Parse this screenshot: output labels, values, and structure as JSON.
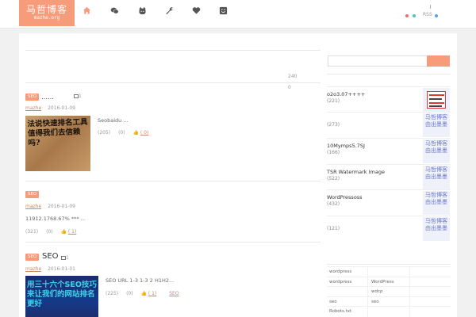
{
  "header": {
    "logo_title": "马哲博客",
    "logo_sub": "mazhe.org",
    "nav": [
      {
        "icon": "home-icon",
        "color": "#f79c7b"
      },
      {
        "icon": "wechat-icon",
        "color": "#555555"
      },
      {
        "icon": "github-icon",
        "color": "#555555"
      },
      {
        "icon": "wrench-icon",
        "color": "#555555"
      },
      {
        "icon": "heart-icon",
        "color": "#555555"
      },
      {
        "icon": "smiley-icon",
        "color": "#555555"
      }
    ],
    "rss_label": "RSS",
    "dot_colors": [
      "#f06b6b",
      "#4cc2c4",
      "#f7b34a",
      "#5aa0e8"
    ]
  },
  "stats": {
    "a": "240",
    "b": "0"
  },
  "posts": [
    {
      "tag": "SEO",
      "title": "……",
      "img_count": "1",
      "author": "mazhe",
      "date": "2016-01-09",
      "excerpt": "Seobaidu ...",
      "views": "(205)",
      "comments": "(0)",
      "likes": "( 0)",
      "thumb_text": "法说快速排名工具值得我们去信赖吗?"
    },
    {
      "tag": "SEO",
      "title": "",
      "author": "mazhe",
      "date": "2016-01-09",
      "excerpt": "11912.1768.67% *** ...",
      "views": "(321)",
      "comments": "(0)",
      "likes": "( 1)"
    },
    {
      "tag": "SEO",
      "title": "SEO",
      "img_count": "1",
      "author": "mazhe",
      "date": "2016-01-01",
      "excerpt": "SEO  URL 1-3 1-3 2    H1H2...",
      "views": "(225)",
      "comments": "(0)",
      "likes": "( 1)",
      "cat": "SEO",
      "thumb_text": "用三十六个SEO技巧来让我们的网站排名更好"
    }
  ],
  "sidebar": {
    "search_placeholder": "",
    "items": [
      {
        "title": "o2o3.07++++",
        "count": "(221)",
        "img": "redbox"
      },
      {
        "title": "",
        "count": "(273)",
        "img": "seal"
      },
      {
        "title": "10Mymps5.7SJ",
        "count": "(166)",
        "img": "seal"
      },
      {
        "title": "TSR Watermark Image",
        "count": "(522)",
        "img": "seal"
      },
      {
        "title": "WordPressoss",
        "count": "(432)",
        "img": "seal"
      },
      {
        "title": "",
        "count": "(121)",
        "img": "seal"
      }
    ],
    "seal_text": "马哲博客 由出墨墨",
    "tags": [
      [
        "wordpress",
        ""
      ],
      [
        "wordpress",
        "WordPress"
      ],
      [
        "",
        "wdcp"
      ],
      [
        "seo",
        "seo"
      ],
      [
        "Robots.txt",
        ""
      ]
    ]
  }
}
